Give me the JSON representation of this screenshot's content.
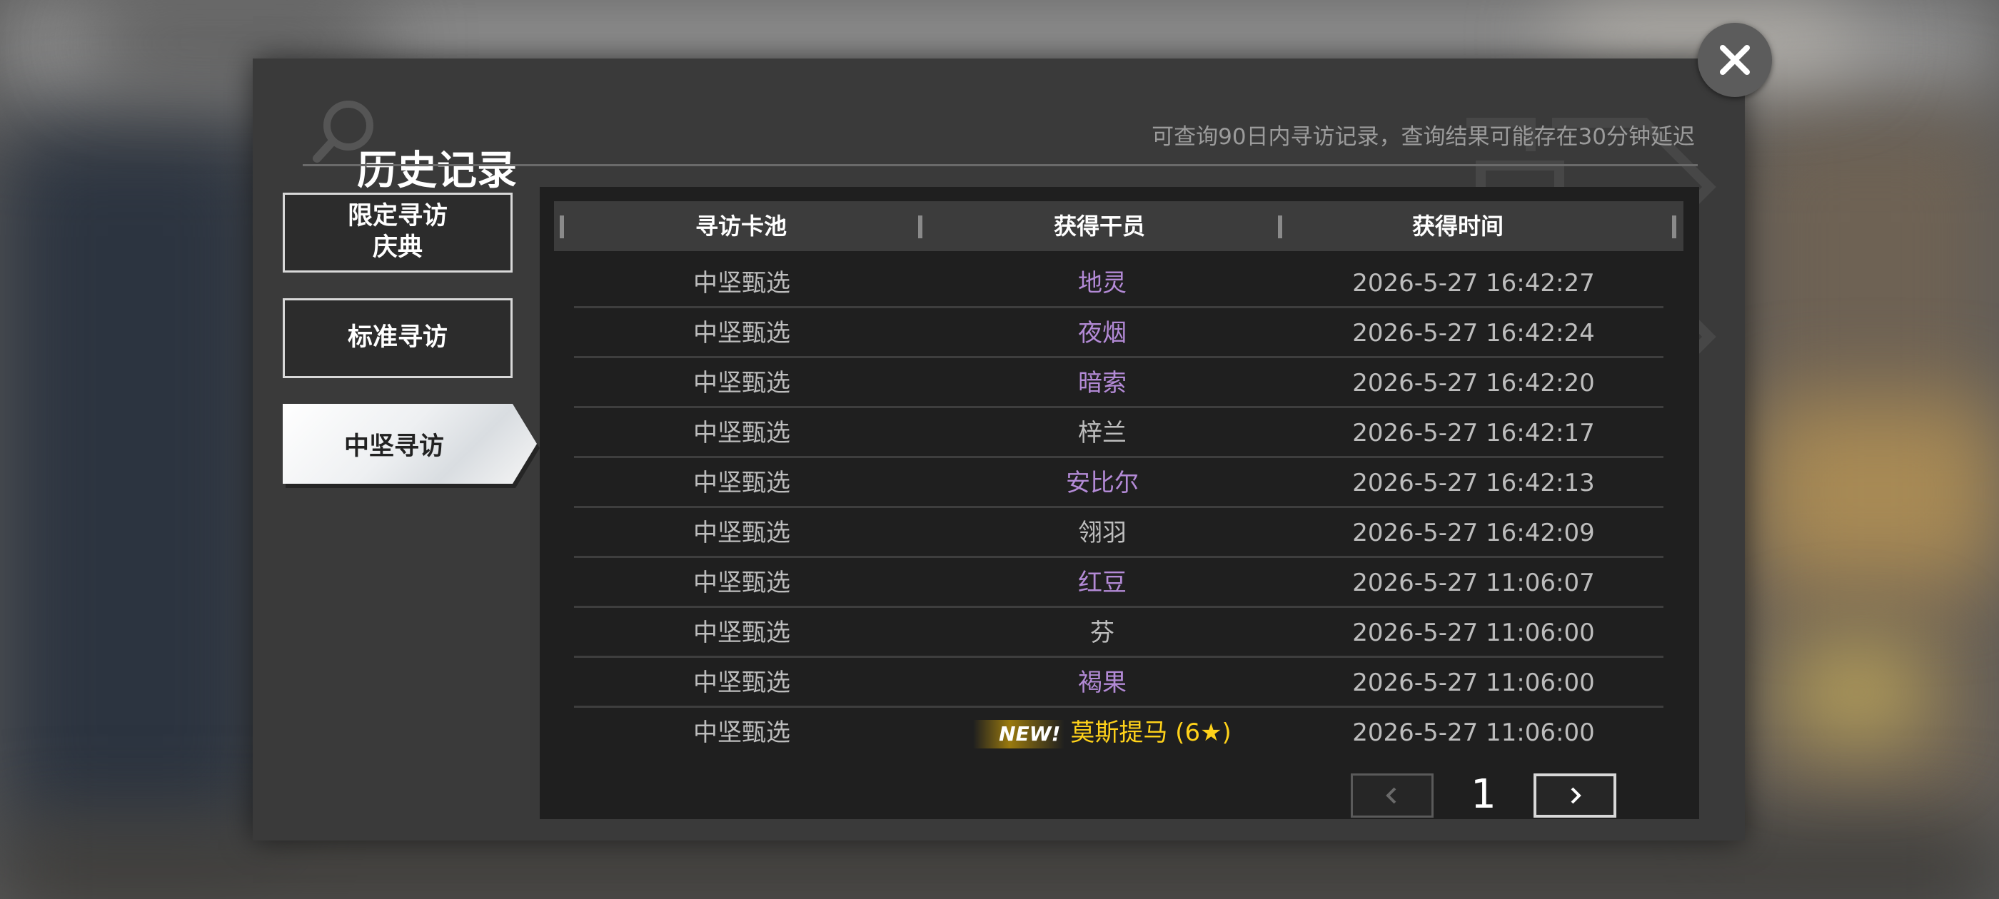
{
  "header": {
    "title": "历史记录",
    "notice": "可查询90日内寻访记录，查询结果可能存在30分钟延迟"
  },
  "tabs": [
    {
      "label": "限定寻访\n庆典",
      "active": false
    },
    {
      "label": "标准寻访",
      "active": false
    },
    {
      "label": "中坚寻访",
      "active": true
    }
  ],
  "table": {
    "columns": [
      "寻访卡池",
      "获得干员",
      "获得时间"
    ],
    "rows": [
      {
        "pool": "中坚甄选",
        "operator": "地灵",
        "time": "2026-5-27 16:42:27",
        "rarity": "purple"
      },
      {
        "pool": "中坚甄选",
        "operator": "夜烟",
        "time": "2026-5-27 16:42:24",
        "rarity": "purple"
      },
      {
        "pool": "中坚甄选",
        "operator": "暗索",
        "time": "2026-5-27 16:42:20",
        "rarity": "purple"
      },
      {
        "pool": "中坚甄选",
        "operator": "梓兰",
        "time": "2026-5-27 16:42:17",
        "rarity": "grey"
      },
      {
        "pool": "中坚甄选",
        "operator": "安比尔",
        "time": "2026-5-27 16:42:13",
        "rarity": "purple"
      },
      {
        "pool": "中坚甄选",
        "operator": "翎羽",
        "time": "2026-5-27 16:42:09",
        "rarity": "grey"
      },
      {
        "pool": "中坚甄选",
        "operator": "红豆",
        "time": "2026-5-27 11:06:07",
        "rarity": "purple"
      },
      {
        "pool": "中坚甄选",
        "operator": "芬",
        "time": "2026-5-27 11:06:00",
        "rarity": "grey"
      },
      {
        "pool": "中坚甄选",
        "operator": "褐果",
        "time": "2026-5-27 11:06:00",
        "rarity": "purple"
      },
      {
        "pool": "中坚甄选",
        "operator": "莫斯提马 (6★)",
        "time": "2026-5-27 11:06:00",
        "rarity": "gold",
        "badge": "NEW!"
      }
    ]
  },
  "pagination": {
    "current_page": "1",
    "prev_icon": "chevron-left-icon",
    "next_icon": "chevron-right-icon"
  },
  "icons": {
    "close": "close-icon",
    "title_decoration": "magnifier-icon"
  },
  "colors": {
    "purple": "#b38ad6",
    "grey": "#bdbdbd",
    "gold": "#ffd21a",
    "panel": "#3a3a3a",
    "table_bg": "#1f1f1f"
  }
}
